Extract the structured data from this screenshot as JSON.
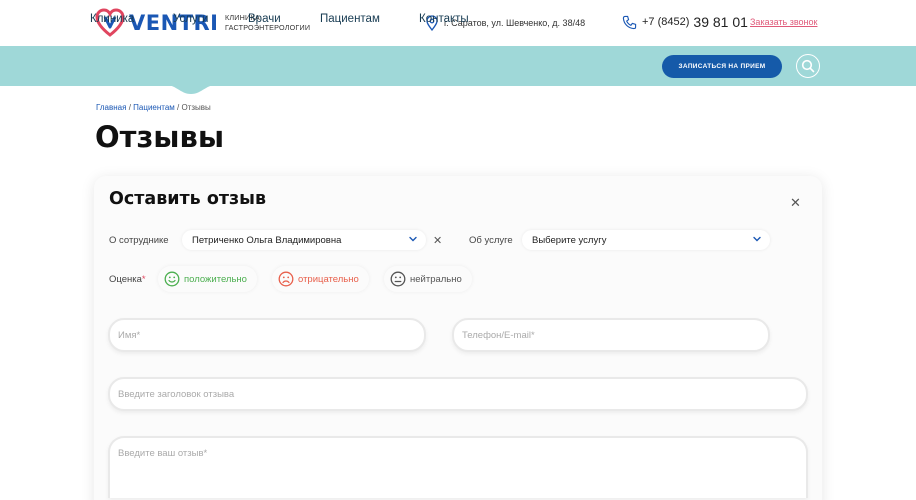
{
  "header": {
    "brand": "VENTRI",
    "brand_sub_line1": "КЛИНИКА",
    "brand_sub_line2": "ГАСТРОЭНТЕРОЛОГИИ",
    "address": "г. Саратов, ул. Шевченко, д. 38/48",
    "phone_prefix": "+7 (8452)",
    "phone_main": "39 81 01",
    "callback_label": "Заказать звонок"
  },
  "nav": {
    "items": [
      "Клиника",
      "Услуги",
      "Врачи",
      "Пациентам",
      "Контакты"
    ],
    "cta_label": "ЗАПИСАТЬСЯ НА ПРИЕМ"
  },
  "breadcrumb": {
    "home": "Главная",
    "parent": "Пациентам",
    "current": "Отзывы",
    "sep": "/"
  },
  "page_title": "Отзывы",
  "review_form": {
    "title": "Оставить отзыв",
    "employee_label": "О сотруднике",
    "employee_value": "Петриченко Ольга Владимировна",
    "service_label": "Об услуге",
    "service_value": "Выберите услугу",
    "rating_label": "Оценка",
    "rating_required_mark": "*",
    "rating_options": [
      "положительно",
      "отрицательно",
      "нейтрально"
    ],
    "name_placeholder": "Имя*",
    "contact_placeholder": "Телефон/E-mail*",
    "subject_placeholder": "Введите заголовок отзыва",
    "review_placeholder": "Введите ваш отзыв*"
  },
  "colors": {
    "brand_blue": "#1a57b4",
    "brand_pink": "#e0455f",
    "nav_bg": "#9fd8d8",
    "cta_bg": "#155aa9",
    "positive": "#4caf50",
    "negative": "#e8604c",
    "neutral": "#555555"
  },
  "icons": {
    "logo": "heart-logo-icon",
    "address": "location-pin-icon",
    "phone": "phone-icon",
    "search": "search-icon",
    "close": "close-icon",
    "select": "chevron-down-icon",
    "clear": "clear-icon",
    "positive": "smile-icon",
    "negative": "frown-icon",
    "neutral": "neutral-face-icon"
  }
}
